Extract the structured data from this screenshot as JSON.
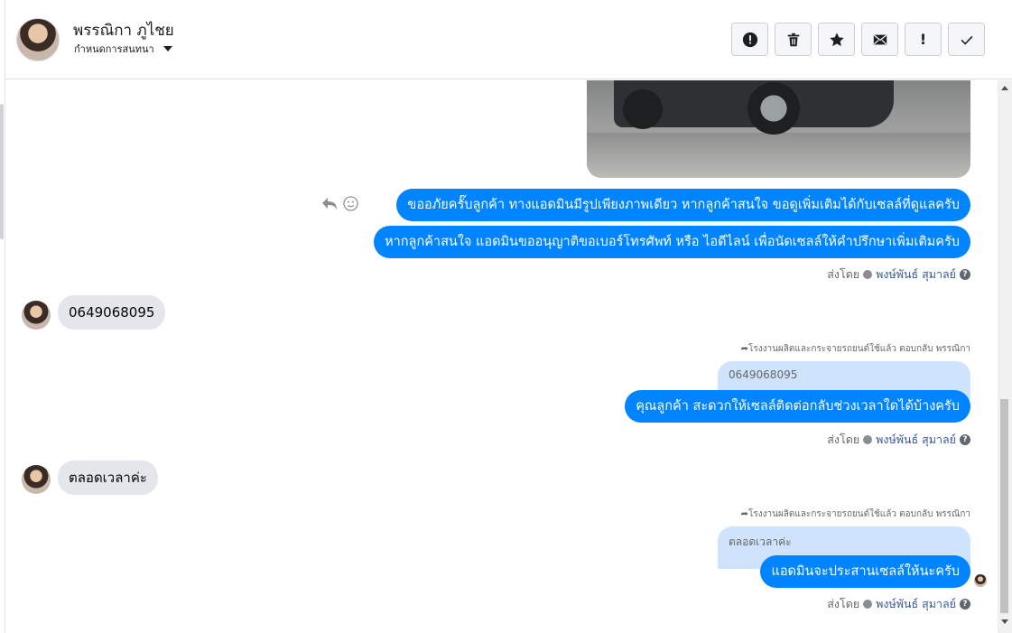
{
  "header": {
    "contact_name": "พรรณิกา ภูไชย",
    "subtitle": "กำหนดการสนทนา"
  },
  "toolbar": {
    "icons": [
      "alert-circle-icon",
      "trash-icon",
      "star-icon",
      "envelope-icon",
      "exclamation-icon",
      "check-icon"
    ],
    "exclamation_label": "!"
  },
  "messages": {
    "out_1": "ขออภัยครั๊บลูกค้า ทางแอดมินมีรูปเพียงภาพเดียว หากลูกค้าสนใจ ขอดูเพิ่มเติมได้กับเซลล์ที่ดูแลครับ",
    "out_2": "หากลูกค้าสนใจ แอดมินขออนุญาติขอเบอร์โทรศัพท์ หรือ ไอดีไลน์ เพื่อนัดเซลล์ให้คำปรึกษาเพิ่มเติมครับ",
    "in_1": "0649068095",
    "out_3": "คุณลูกค้า สะดวกให้เซลล์ติดต่อกลับช่วงเวลาใดได้บ้างครับ",
    "in_2": "ตลอดเวลาค่ะ",
    "out_4": "แอดมินจะประสานเซลล์ให้นะครับ"
  },
  "sent_by": {
    "prefix": "ส่งโดย",
    "agent": "พงษ์พันธ์ สุมาลย์",
    "help": "?"
  },
  "reply_meta": {
    "text": "โรงงานผลิตและกระจายรถยนต์ใช้แล้ว ตอบกลับ พรรณิกา"
  },
  "quotes": {
    "q1": "0649068095",
    "q2": "ตลอดเวลาค่ะ"
  },
  "colors": {
    "outgoing_bubble": "#0084ff",
    "incoming_bubble": "#e4e6eb",
    "quote_bubble": "#cfe3fc"
  }
}
